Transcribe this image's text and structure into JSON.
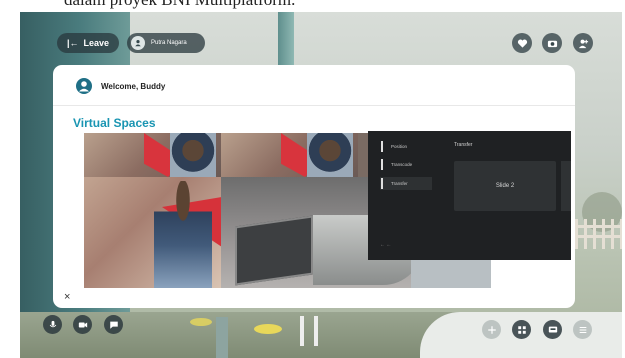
{
  "caption": "dalam proyek BNI Multiplatform.",
  "topbar": {
    "leave_label": "Leave",
    "user_name": "Putra Nagara"
  },
  "modal": {
    "welcome": "Welcome, Buddy",
    "section_title": "Virtual Spaces",
    "close_symbol": "×"
  },
  "panel": {
    "nav_items": [
      "Position",
      "Transcode",
      "Transfer"
    ],
    "selected_nav": "Transfer",
    "title": "Transfer",
    "slide_label": "Slide 2",
    "footer": "← ←"
  },
  "icons": {
    "top_right": [
      "heart-icon",
      "camera-icon",
      "user-add-icon"
    ],
    "bottom_left": [
      "microphone-icon",
      "video-icon",
      "chat-icon"
    ],
    "bottom_right": [
      "plus-icon",
      "grid-icon",
      "screen-share-icon",
      "menu-icon"
    ]
  },
  "colors": {
    "accent": "#1a95b2",
    "avatar": "#1f6f86",
    "pill_bg": "#28373c"
  }
}
